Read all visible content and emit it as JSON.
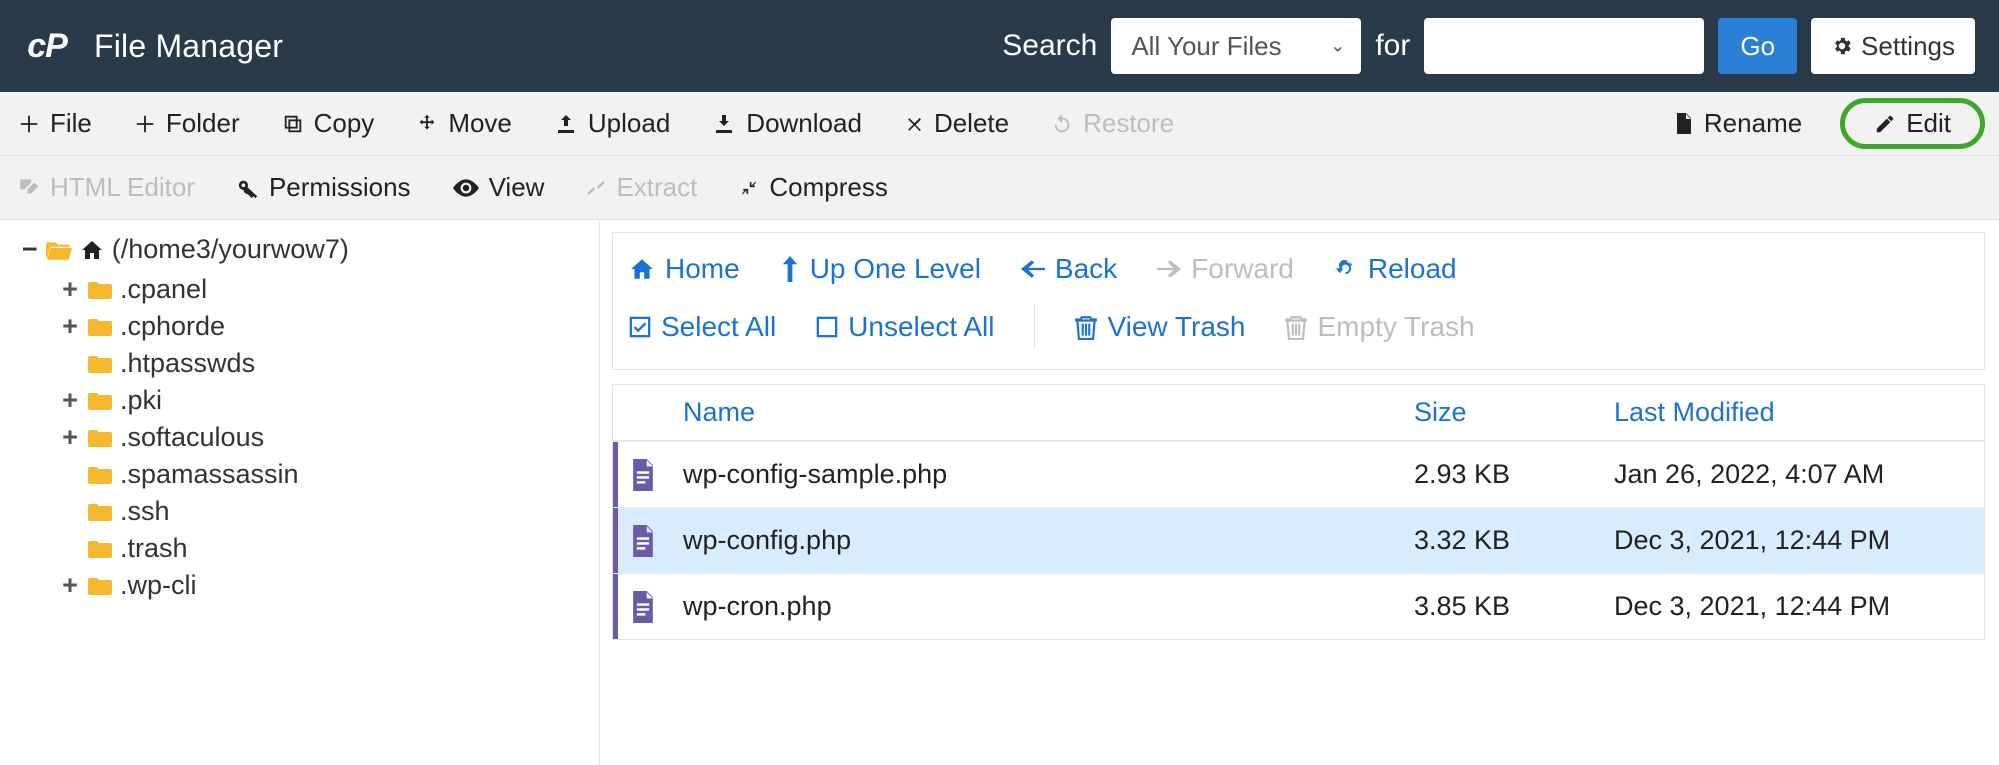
{
  "header": {
    "app_title": "File Manager",
    "search_label": "Search",
    "search_scope": "All Your Files",
    "for_label": "for",
    "search_value": "",
    "go_label": "Go",
    "settings_label": "Settings"
  },
  "toolbar1": {
    "file": "File",
    "folder": "Folder",
    "copy": "Copy",
    "move": "Move",
    "upload": "Upload",
    "download": "Download",
    "delete": "Delete",
    "restore": "Restore",
    "rename": "Rename",
    "edit": "Edit"
  },
  "toolbar2": {
    "html_editor": "HTML Editor",
    "permissions": "Permissions",
    "view": "View",
    "extract": "Extract",
    "compress": "Compress"
  },
  "tree": {
    "root_label": "(/home3/yourwow7)",
    "items": [
      {
        "expandable": true,
        "label": ".cpanel"
      },
      {
        "expandable": true,
        "label": ".cphorde"
      },
      {
        "expandable": false,
        "label": ".htpasswds"
      },
      {
        "expandable": true,
        "label": ".pki"
      },
      {
        "expandable": true,
        "label": ".softaculous"
      },
      {
        "expandable": false,
        "label": ".spamassassin"
      },
      {
        "expandable": false,
        "label": ".ssh"
      },
      {
        "expandable": false,
        "label": ".trash"
      },
      {
        "expandable": true,
        "label": ".wp-cli"
      }
    ]
  },
  "nav": {
    "home": "Home",
    "up": "Up One Level",
    "back": "Back",
    "forward": "Forward",
    "reload": "Reload",
    "select_all": "Select All",
    "unselect_all": "Unselect All",
    "view_trash": "View Trash",
    "empty_trash": "Empty Trash"
  },
  "table": {
    "columns": {
      "name": "Name",
      "size": "Size",
      "modified": "Last Modified"
    },
    "rows": [
      {
        "name": "wp-config-sample.php",
        "size": "2.93 KB",
        "modified": "Jan 26, 2022, 4:07 AM",
        "selected": false
      },
      {
        "name": "wp-config.php",
        "size": "3.32 KB",
        "modified": "Dec 3, 2021, 12:44 PM",
        "selected": true
      },
      {
        "name": "wp-cron.php",
        "size": "3.85 KB",
        "modified": "Dec 3, 2021, 12:44 PM",
        "selected": false
      }
    ]
  }
}
